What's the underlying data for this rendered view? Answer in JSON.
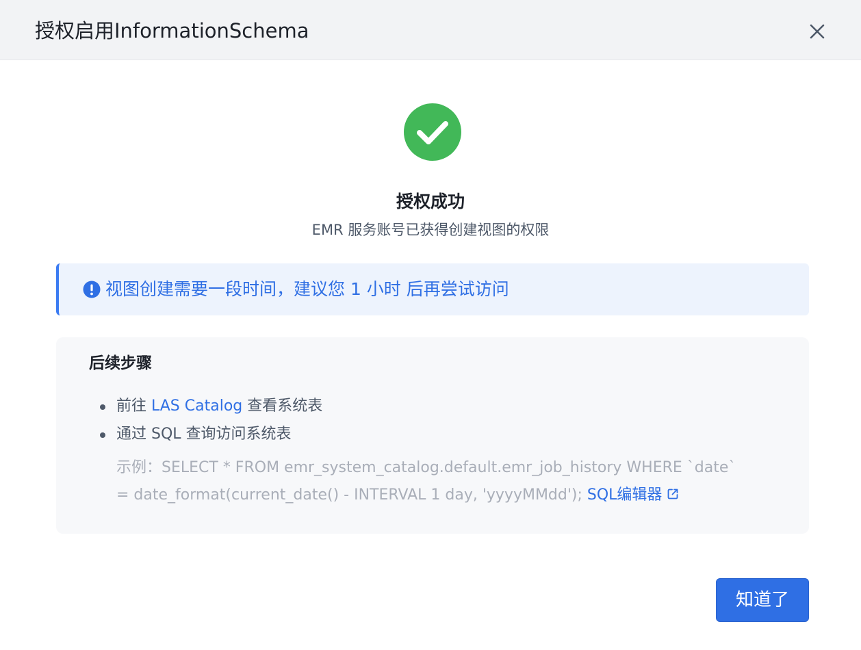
{
  "dialog": {
    "title": "授权启用InformationSchema"
  },
  "result": {
    "status": "success",
    "title": "授权成功",
    "subtitle": "EMR 服务账号已获得创建视图的权限"
  },
  "alert": {
    "icon": "info-icon",
    "text": "视图创建需要一段时间，建议您 1 小时 后再尝试访问"
  },
  "next_steps": {
    "title": "后续步骤",
    "step1": {
      "prefix": "前往 ",
      "link": "LAS Catalog",
      "suffix": " 查看系统表"
    },
    "step2": {
      "text": "通过 SQL 查询访问系统表"
    },
    "example": {
      "line1": "示例：SELECT * FROM emr_system_catalog.default.emr_job_history WHERE `date`",
      "line2": "= date_format(current_date() - INTERVAL 1 day, 'yyyyMMdd'); ",
      "link": "SQL编辑器",
      "link_icon": "external-link-icon"
    }
  },
  "footer": {
    "ok_label": "知道了"
  },
  "colors": {
    "primary": "#2f6fe4",
    "success": "#42b858",
    "alert_bg": "#edf3fd",
    "header_bg": "#f2f3f5",
    "card_bg": "#f7f8fa"
  }
}
